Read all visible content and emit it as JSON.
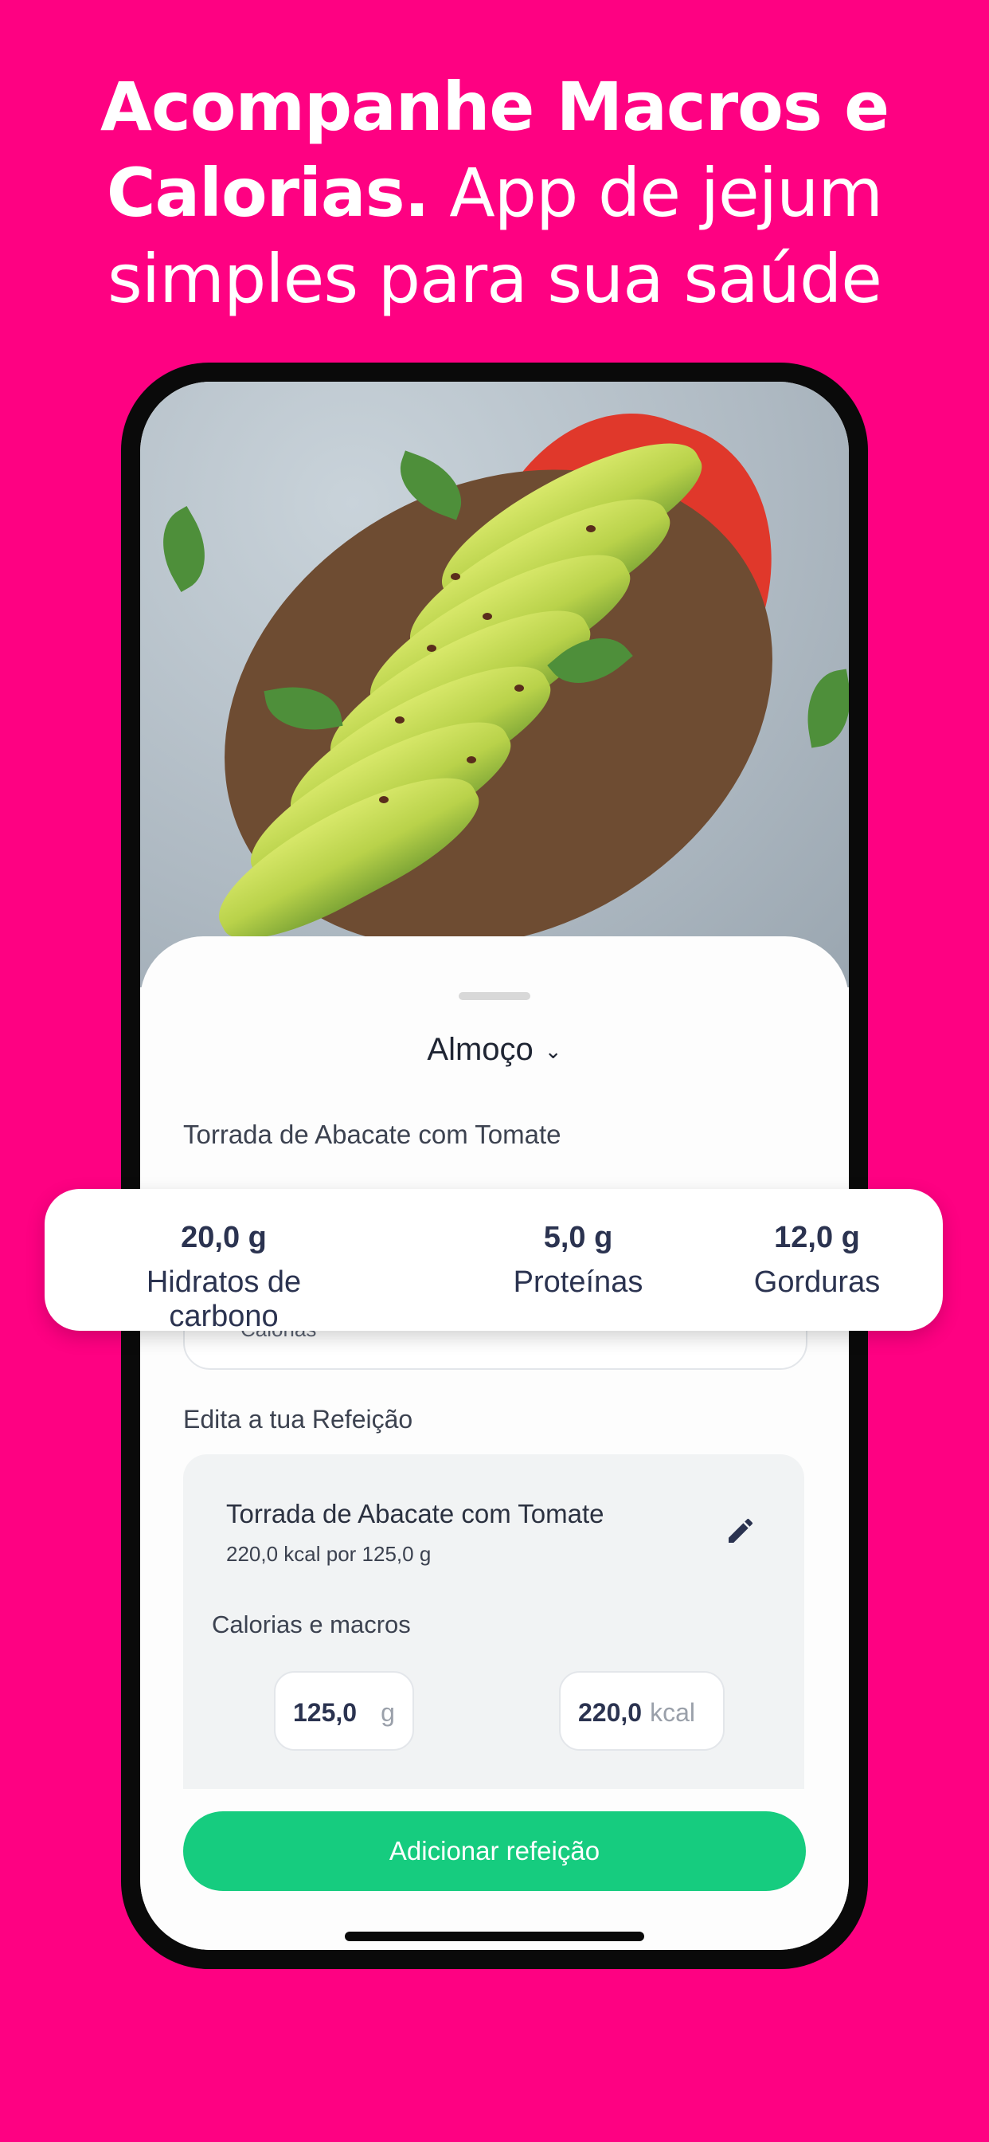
{
  "headline": {
    "bold_part": "Acompanhe Macros e Calorias.",
    "light_part": "App de jejum simples para sua saúde"
  },
  "sheet": {
    "meal_selector": "Almoço",
    "food_title": "Torrada de Abacate com Tomate",
    "calories_label": "Calorias",
    "edit_section_label": "Edita a tua Refeição",
    "edit_card": {
      "name": "Torrada de Abacate com Tomate",
      "subtitle": "220,0 kcal por 125,0 g",
      "macros_label": "Calorias e macros",
      "grams_value": "125,0",
      "grams_unit": "g",
      "kcal_value": "220,0",
      "kcal_unit": "kcal"
    },
    "add_button": "Adicionar refeição"
  },
  "macros": [
    {
      "amount": "20,0 g",
      "label": "Hidratos de carbono"
    },
    {
      "amount": "5,0 g",
      "label": "Proteínas"
    },
    {
      "amount": "12,0 g",
      "label": "Gorduras"
    }
  ],
  "colors": {
    "background": "#fe0182",
    "button": "#16cc7f",
    "text_dark": "#2b3350"
  },
  "icons": [
    "chevron-down-icon",
    "pencil-icon"
  ]
}
